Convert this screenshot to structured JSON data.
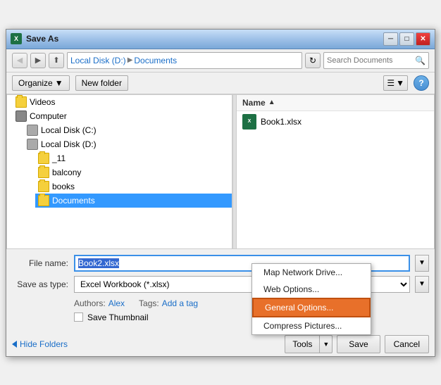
{
  "dialog": {
    "title": "Save As",
    "title_icon": "X"
  },
  "toolbar": {
    "back_label": "◀",
    "forward_label": "▶",
    "up_label": "▲",
    "address": {
      "parts": [
        "Local Disk (D:)",
        "Documents"
      ]
    },
    "refresh_label": "↻",
    "search_placeholder": "Search Documents",
    "search_icon_label": "🔍"
  },
  "second_toolbar": {
    "organize_label": "Organize",
    "organize_arrow": "▼",
    "new_folder_label": "New folder",
    "view_icon1": "☰",
    "view_icon2": "▼",
    "help_label": "?"
  },
  "left_panel": {
    "items": [
      {
        "label": "Videos",
        "type": "folder",
        "indent": "indent-1"
      },
      {
        "label": "Computer",
        "type": "computer",
        "indent": "indent-1"
      },
      {
        "label": "Local Disk (C:)",
        "type": "drive",
        "indent": "indent-2"
      },
      {
        "label": "Local Disk (D:)",
        "type": "drive",
        "indent": "indent-2"
      },
      {
        "label": "_11",
        "type": "folder",
        "indent": "indent-3"
      },
      {
        "label": "balcony",
        "type": "folder",
        "indent": "indent-3"
      },
      {
        "label": "books",
        "type": "folder",
        "indent": "indent-3"
      },
      {
        "label": "Documents",
        "type": "folder",
        "indent": "indent-3",
        "selected": true
      }
    ]
  },
  "right_panel": {
    "header": "Name",
    "sort_arrow": "▲",
    "files": [
      {
        "name": "Book1.xlsx"
      }
    ]
  },
  "form": {
    "filename_label": "File name:",
    "filename_value": "Book2.xlsx",
    "savetype_label": "Save as type:",
    "savetype_value": "Excel Workbook (*.xlsx)",
    "authors_label": "Authors:",
    "authors_value": "Alex",
    "tags_label": "Tags:",
    "tags_value": "Add a tag",
    "thumbnail_label": "Save Thumbnail"
  },
  "bottom_buttons": {
    "hide_folders_label": "Hide Folders",
    "tools_label": "Tools",
    "save_label": "Save",
    "cancel_label": "Cancel"
  },
  "dropdown_menu": {
    "items": [
      {
        "label": "Map Network Drive...",
        "highlighted": false
      },
      {
        "label": "Web Options...",
        "highlighted": false
      },
      {
        "label": "General Options...",
        "highlighted": true
      },
      {
        "label": "Compress Pictures...",
        "highlighted": false
      }
    ]
  }
}
